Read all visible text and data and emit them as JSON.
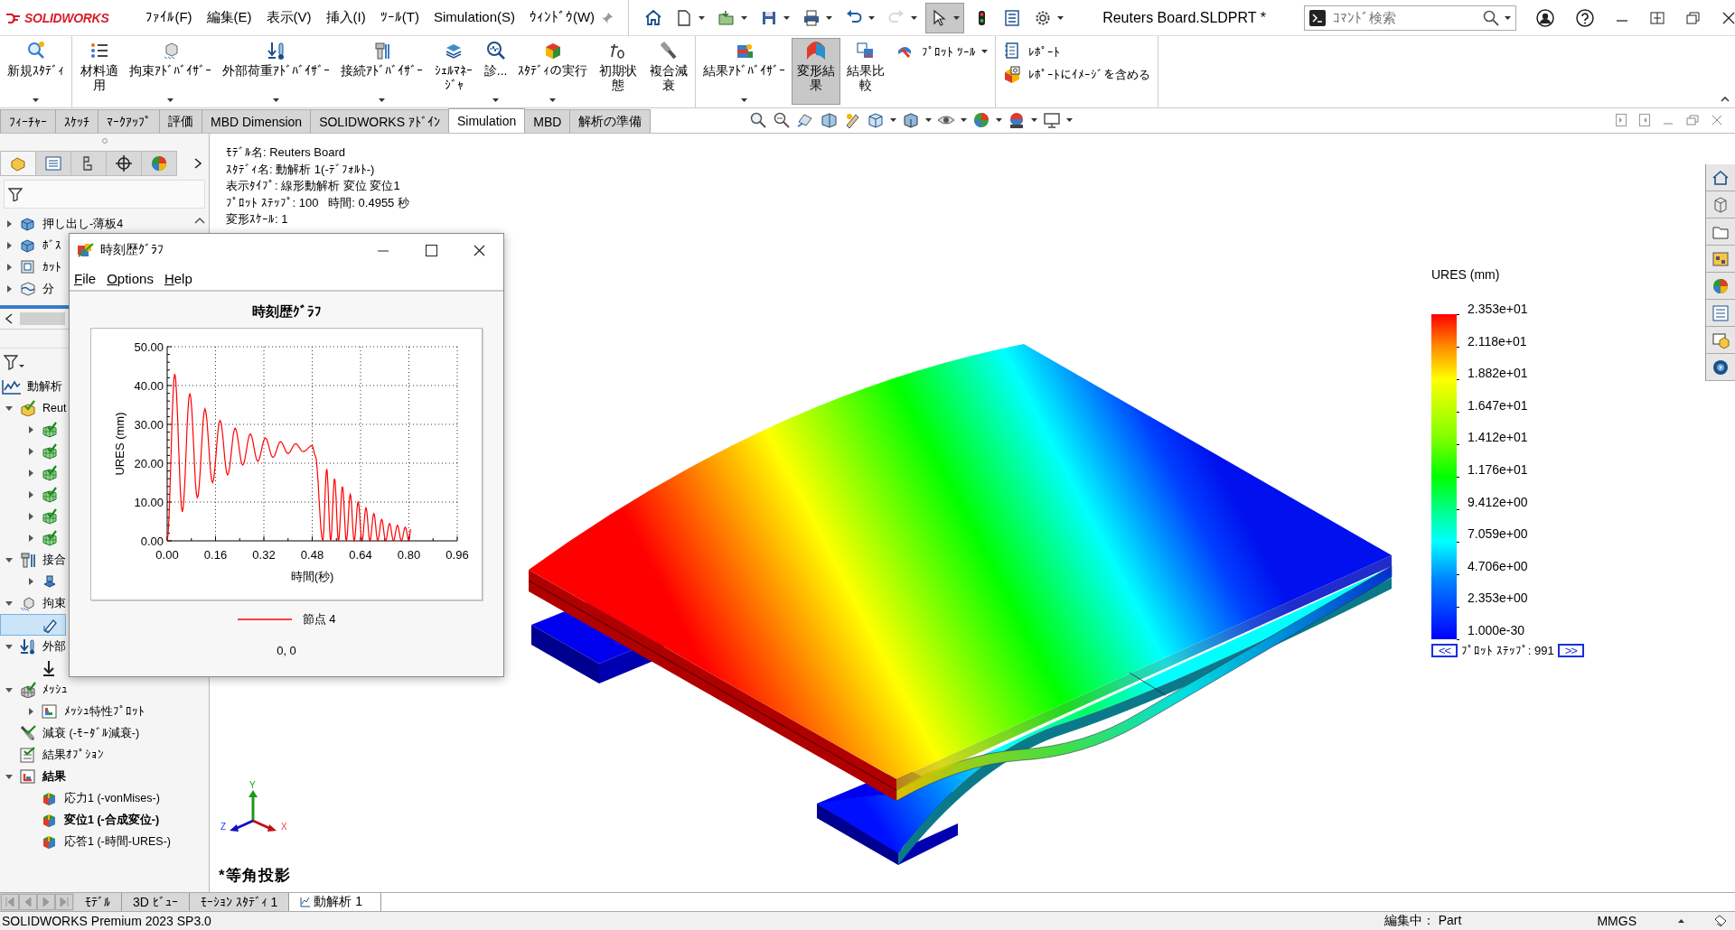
{
  "app": {
    "logo": "SOLIDWORKS",
    "title": "Reuters Board.SLDPRT *",
    "search_placeholder": "ｺﾏﾝﾄﾞ検索"
  },
  "menu": [
    "ﾌｧｲﾙ(F)",
    "編集(E)",
    "表示(V)",
    "挿入(I)",
    "ﾂｰﾙ(T)",
    "Simulation(S)",
    "ｳｨﾝﾄﾞｳ(W)"
  ],
  "quick_access": [
    {
      "dropdown": false,
      "pressed": false,
      "disabled": false
    },
    {
      "dropdown": true,
      "pressed": false,
      "disabled": false
    },
    {
      "dropdown": true,
      "pressed": false,
      "disabled": false
    },
    {
      "dropdown": true,
      "pressed": false,
      "disabled": false
    },
    {
      "dropdown": true,
      "pressed": false,
      "disabled": false
    },
    {
      "dropdown": true,
      "pressed": false,
      "disabled": false
    },
    {
      "dropdown": true,
      "pressed": false,
      "disabled": true
    },
    {
      "dropdown": true,
      "pressed": true,
      "disabled": false
    },
    {
      "dropdown": false,
      "pressed": false,
      "disabled": false
    },
    {
      "dropdown": false,
      "pressed": false,
      "disabled": false
    },
    {
      "dropdown": true,
      "pressed": false,
      "disabled": false
    }
  ],
  "ribbon": {
    "groups": [
      {
        "buttons": [
          {
            "label": "新規ｽﾀﾃﾞｨ",
            "kind": "wide",
            "dropdown": true,
            "pressed": false
          }
        ]
      },
      {
        "buttons": [
          {
            "label": "材料適用",
            "kind": "narrow",
            "dropdown": false,
            "pressed": false
          },
          {
            "label": "拘束ｱﾄﾞﾊﾞｲｻﾞｰ",
            "kind": "wide",
            "dropdown": true,
            "pressed": false
          },
          {
            "label": "外部荷重ｱﾄﾞﾊﾞｲｻﾞｰ",
            "kind": "wide",
            "dropdown": true,
            "pressed": false
          },
          {
            "label": "接続ｱﾄﾞﾊﾞｲｻﾞｰ",
            "kind": "wide",
            "dropdown": true,
            "pressed": false
          },
          {
            "label": "ｼｪﾙﾏﾈｰｼﾞｬ",
            "kind": "narrow",
            "dropdown": false,
            "pressed": false
          },
          {
            "label": "診...",
            "kind": "wide",
            "dropdown": true,
            "pressed": false
          },
          {
            "label": "ｽﾀﾃﾞｨの実行",
            "kind": "wide",
            "dropdown": true,
            "pressed": false
          },
          {
            "label": "初期状態",
            "kind": "narrow",
            "dropdown": false,
            "pressed": false
          },
          {
            "label": "複合減衰",
            "kind": "narrow",
            "dropdown": false,
            "pressed": false
          }
        ]
      },
      {
        "buttons": [
          {
            "label": "結果ｱﾄﾞﾊﾞｲｻﾞｰ",
            "kind": "wide",
            "dropdown": true,
            "pressed": false
          },
          {
            "label": "変形結果",
            "kind": "narrow",
            "dropdown": false,
            "pressed": true
          },
          {
            "label": "結果比較",
            "kind": "narrow",
            "dropdown": false,
            "pressed": false
          },
          {
            "label": "ﾌﾟﾛｯﾄ ﾂｰﾙ",
            "kind": "small",
            "dropdown": true,
            "pressed": false
          }
        ]
      },
      {
        "buttons": [
          {
            "label": "ﾚﾎﾟｰﾄ",
            "kind": "small",
            "dropdown": false,
            "pressed": false
          },
          {
            "label": "ﾚﾎﾟｰﾄにｲﾒｰｼﾞを含める",
            "kind": "small",
            "dropdown": false,
            "pressed": false
          }
        ]
      }
    ]
  },
  "tabs": [
    {
      "label": "ﾌｨｰﾁｬｰ",
      "selected": false
    },
    {
      "label": "ｽｹｯﾁ",
      "selected": false
    },
    {
      "label": "ﾏｰｸｱｯﾌﾟ",
      "selected": false
    },
    {
      "label": "評価",
      "selected": false
    },
    {
      "label": "MBD Dimension",
      "selected": false
    },
    {
      "label": "SOLIDWORKS ｱﾄﾞｲﾝ",
      "selected": false
    },
    {
      "label": "Simulation",
      "selected": true
    },
    {
      "label": "MBD",
      "selected": false
    },
    {
      "label": "解析の準備",
      "selected": false
    }
  ],
  "feature_tree": {
    "items": [
      {
        "label": "押し出し-薄板4",
        "kind": "feature",
        "expanded": false
      },
      {
        "label": "ﾎﾞｽ",
        "kind": "feature",
        "expanded": false
      },
      {
        "label": "ｶｯﾄ",
        "kind": "cut",
        "expanded": false
      },
      {
        "label": "分",
        "kind": "split",
        "expanded": false
      }
    ]
  },
  "study_tree": {
    "study": "動解析",
    "items": [
      {
        "label": "Reut",
        "kind": "part",
        "expanded": true,
        "selected": false,
        "active": false,
        "children": [
          {
            "kind": "body",
            "expanded": false,
            "selected": false
          },
          {
            "kind": "body",
            "expanded": false,
            "selected": false
          },
          {
            "kind": "body",
            "expanded": false,
            "selected": false
          },
          {
            "kind": "body",
            "expanded": false,
            "selected": false
          },
          {
            "kind": "body",
            "expanded": false,
            "selected": false
          },
          {
            "kind": "body",
            "expanded": false,
            "selected": false
          }
        ]
      },
      {
        "label": "接合",
        "kind": "connection",
        "expanded": true,
        "selected": false,
        "active": false,
        "children": [
          {
            "kind": "contact",
            "expanded": false,
            "selected": false
          }
        ]
      },
      {
        "label": "拘束",
        "kind": "fixture",
        "expanded": true,
        "selected": false,
        "active": false,
        "children": [
          {
            "kind": "fixed",
            "selected": true
          }
        ]
      },
      {
        "label": "外部",
        "kind": "load",
        "expanded": true,
        "selected": false,
        "active": false,
        "children": [
          {
            "kind": "force",
            "selected": false
          }
        ]
      },
      {
        "label": "ﾒｯｼｭ",
        "kind": "mesh",
        "expanded": true,
        "selected": false,
        "active": false,
        "children": [
          {
            "label": "ﾒｯｼｭ特性ﾌﾟﾛｯﾄ",
            "kind": "plot-folder",
            "expanded": false,
            "selected": false,
            "active": false
          }
        ]
      },
      {
        "label": "減衰 (-ﾓｰﾀﾞﾙ減衰-)",
        "kind": "damping",
        "selected": false,
        "active": false
      },
      {
        "label": "結果ｵﾌﾟｼｮﾝ",
        "kind": "options",
        "selected": false,
        "active": false
      },
      {
        "label": "結果",
        "kind": "results",
        "expanded": true,
        "selected": false,
        "active": true,
        "children": [
          {
            "label": "応力1 (-vonMises-)",
            "kind": "plot",
            "selected": false,
            "active": false
          },
          {
            "label": "変位1 (-合成変位-)",
            "kind": "plot",
            "selected": false,
            "active": true
          },
          {
            "label": "応答1 (-時間-URES-)",
            "kind": "plot",
            "selected": false,
            "active": false
          }
        ]
      }
    ]
  },
  "viewport": {
    "info": [
      "ﾓﾃﾞﾙ名: Reuters Board",
      "ｽﾀﾃﾞｨ名: 動解析 1(-ﾃﾞﾌｫﾙﾄ-)",
      "表示ﾀｲﾌﾟ: 線形動解析 変位 変位1",
      "ﾌﾟﾛｯﾄ ｽﾃｯﾌﾟ: 100   時間: 0.4955 秒",
      "変形ｽｹｰﾙ: 1"
    ],
    "legend": {
      "title": "URES (mm)",
      "labels": [
        "2.353e+01",
        "2.118e+01",
        "1.882e+01",
        "1.647e+01",
        "1.412e+01",
        "1.176e+01",
        "9.412e+00",
        "7.059e+00",
        "4.706e+00",
        "2.353e+00",
        "1.000e-30"
      ],
      "prev": "<<",
      "step": "ﾌﾟﾛｯﾄ ｽﾃｯﾌﾟ: 991",
      "next": ">>"
    },
    "triad": [
      "X",
      "Y",
      "Z"
    ],
    "view_name": "*等角投影"
  },
  "graph_dialog": {
    "title": "時刻歴ｸﾞﾗﾌ",
    "menu": [
      "File",
      "Options",
      "Help"
    ],
    "cursor_readout": "0, 0",
    "chart_data": {
      "type": "line",
      "title": "時刻歴ｸﾞﾗﾌ",
      "xlabel": "時間(秒)",
      "ylabel": "URES (mm)",
      "grid": true,
      "x": [
        0,
        0.025,
        0.05,
        0.075,
        0.1,
        0.125,
        0.15,
        0.175,
        0.2,
        0.225,
        0.25,
        0.275,
        0.3,
        0.325,
        0.35,
        0.375,
        0.4,
        0.425,
        0.45,
        0.48,
        0.49,
        0.515,
        0.528,
        0.541,
        0.554,
        0.567,
        0.58,
        0.593,
        0.606,
        0.619,
        0.632,
        0.645,
        0.658,
        0.671,
        0.684,
        0.697,
        0.71,
        0.723,
        0.736,
        0.749,
        0.762,
        0.775,
        0.788,
        0.8,
        0.806
      ],
      "series": [
        {
          "name": "節点 4",
          "color": "#ff0000",
          "values": [
            0,
            43,
            7.5,
            38,
            11,
            34,
            15,
            31,
            17,
            29,
            19.5,
            27.5,
            20.5,
            26.5,
            21.5,
            25.5,
            22.5,
            25,
            23,
            24.5,
            22,
            0,
            18.5,
            0,
            16,
            0,
            14,
            0,
            12,
            0,
            10,
            0,
            8.5,
            0,
            7,
            0,
            5.5,
            0,
            4.5,
            0,
            4,
            0,
            3.5,
            0,
            3
          ]
        }
      ],
      "xlim": [
        0,
        0.96
      ],
      "ylim": [
        0,
        50
      ],
      "xticks": [
        {
          "value": 0,
          "label": "0.00"
        },
        {
          "value": 0.16,
          "label": "0.16"
        },
        {
          "value": 0.32,
          "label": "0.32"
        },
        {
          "value": 0.48,
          "label": "0.48"
        },
        {
          "value": 0.64,
          "label": "0.64"
        },
        {
          "value": 0.8,
          "label": "0.80"
        },
        {
          "value": 0.96,
          "label": "0.96"
        }
      ],
      "yticks": [
        {
          "value": 0,
          "label": "0.00"
        },
        {
          "value": 10,
          "label": "10.00"
        },
        {
          "value": 20,
          "label": "20.00"
        },
        {
          "value": 30,
          "label": "30.00"
        },
        {
          "value": 40,
          "label": "40.00"
        },
        {
          "value": 50,
          "label": "50.00"
        }
      ]
    }
  },
  "bottom_tabs": [
    {
      "label": "ﾓﾃﾞﾙ",
      "selected": false
    },
    {
      "label": "3D ﾋﾞｭｰ",
      "selected": false
    },
    {
      "label": "ﾓｰｼｮﾝ ｽﾀﾃﾞｨ 1",
      "selected": false
    },
    {
      "label": "動解析 1",
      "selected": true
    }
  ],
  "status_bar": {
    "product": "SOLIDWORKS Premium 2023 SP3.0",
    "mode": "編集中： Part",
    "units": "MMGS"
  }
}
